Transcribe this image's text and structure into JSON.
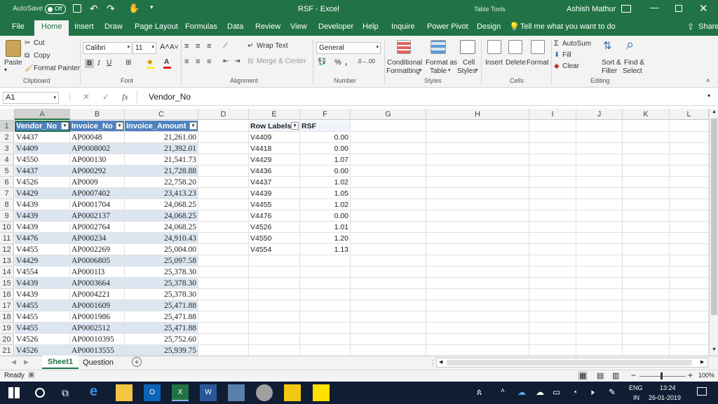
{
  "titlebar": {
    "autosave": "AutoSave",
    "autosave_state": "Off",
    "doc_title": "RSF",
    "app_name": "Excel",
    "context": "Table Tools",
    "user": "Ashish Mathur"
  },
  "tabs": [
    "File",
    "Home",
    "Insert",
    "Draw",
    "Page Layout",
    "Formulas",
    "Data",
    "Review",
    "View",
    "Developer",
    "Help",
    "Inquire",
    "Power Pivot",
    "Design"
  ],
  "tell_me": "Tell me what you want to do",
  "share": "Share",
  "ribbon": {
    "clipboard": {
      "paste": "Paste",
      "cut": "Cut",
      "copy": "Copy",
      "format_painter": "Format Painter",
      "label": "Clipboard"
    },
    "font": {
      "name": "Calibri",
      "size": "11",
      "label": "Font"
    },
    "alignment": {
      "wrap": "Wrap Text",
      "merge": "Merge & Center",
      "label": "Alignment"
    },
    "number": {
      "format": "General",
      "label": "Number"
    },
    "styles": {
      "conditional": "Conditional",
      "formatting": "Formatting",
      "format_as": "Format as",
      "table": "Table",
      "cell": "Cell",
      "cell_styles": "Styles",
      "label": "Styles"
    },
    "cells": {
      "insert": "Insert",
      "delete": "Delete",
      "format": "Format",
      "label": "Cells"
    },
    "editing": {
      "autosum": "AutoSum",
      "fill": "Fill",
      "clear": "Clear",
      "sort": "Sort &",
      "filter": "Filter",
      "find": "Find &",
      "select": "Select",
      "label": "Editing"
    }
  },
  "formula_bar": {
    "name_box": "A1",
    "fx": "fx",
    "value": "Vendor_No"
  },
  "columns": [
    "A",
    "B",
    "C",
    "D",
    "E",
    "F",
    "G",
    "H",
    "I",
    "J",
    "K",
    "L"
  ],
  "row_numbers": [
    "1",
    "2",
    "3",
    "4",
    "5",
    "6",
    "7",
    "8",
    "9",
    "10",
    "11",
    "12",
    "13",
    "14",
    "15",
    "16",
    "17",
    "18",
    "19",
    "20",
    "21"
  ],
  "table": {
    "headers": [
      "Vendor_No",
      "Invoice_No",
      "Invoice_Amount"
    ],
    "rows": [
      [
        "V4437",
        "AP00048",
        "21,261.00"
      ],
      [
        "V4409",
        "AP0008002",
        "21,392.01"
      ],
      [
        "V4550",
        "AP000130",
        "21,541.73"
      ],
      [
        "V4437",
        "AP000292",
        "21,728.88"
      ],
      [
        "V4526",
        "AP0009",
        "22,758.20"
      ],
      [
        "V4429",
        "AP0007402",
        "23,413.23"
      ],
      [
        "V4439",
        "AP0001704",
        "24,068.25"
      ],
      [
        "V4439",
        "AP0002137",
        "24,068.25"
      ],
      [
        "V4439",
        "AP0002764",
        "24,068.25"
      ],
      [
        "V4476",
        "AP000234",
        "24,910.43"
      ],
      [
        "V4455",
        "AP0002269",
        "25,004.00"
      ],
      [
        "V4429",
        "AP0006805",
        "25,097.58"
      ],
      [
        "V4554",
        "AP0001I3",
        "25,378.30"
      ],
      [
        "V4439",
        "AP0003664",
        "25,378.30"
      ],
      [
        "V4439",
        "AP0004221",
        "25,378.30"
      ],
      [
        "V4455",
        "AP0001609",
        "25,471.88"
      ],
      [
        "V4455",
        "AP0001986",
        "25,471.88"
      ],
      [
        "V4455",
        "AP0002512",
        "25,471.88"
      ],
      [
        "V4526",
        "AP00010395",
        "25,752.60"
      ],
      [
        "V4526",
        "AP00013555",
        "25,939.75"
      ]
    ]
  },
  "pivot": {
    "header_labels": "Row Labels",
    "header_value": "RSF",
    "rows": [
      [
        "V4409",
        "0.00"
      ],
      [
        "V4418",
        "0.00"
      ],
      [
        "V4429",
        "1.07"
      ],
      [
        "V4436",
        "0.00"
      ],
      [
        "V4437",
        "1.02"
      ],
      [
        "V4439",
        "1.05"
      ],
      [
        "V4455",
        "1.02"
      ],
      [
        "V4476",
        "0.00"
      ],
      [
        "V4526",
        "1.01"
      ],
      [
        "V4550",
        "1.20"
      ],
      [
        "V4554",
        "1.13"
      ]
    ]
  },
  "sheets": [
    "Sheet1",
    "Question"
  ],
  "status": {
    "ready": "Ready",
    "zoom": "100%"
  },
  "taskbar": {
    "lang": "ENG",
    "region": "IN",
    "time": "13:24",
    "date": "26-01-2019"
  },
  "colors": {
    "excel_green": "#217346",
    "table_header": "#4f81bd",
    "table_band": "#dce6f1",
    "taskbar": "#101d33"
  }
}
